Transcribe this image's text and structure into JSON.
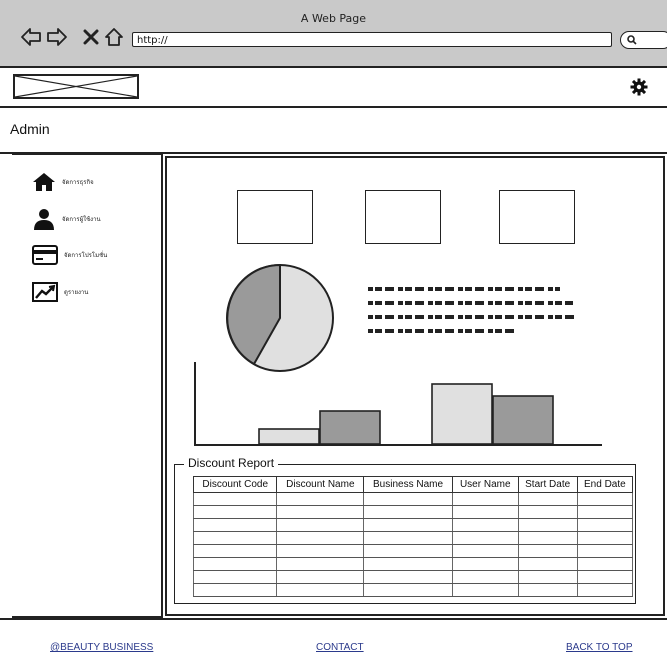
{
  "browser": {
    "title": "A Web Page",
    "url": "http://"
  },
  "header": {
    "admin_label": "Admin"
  },
  "sidebar": {
    "items": [
      {
        "label": "จัดการธุรกิจ",
        "icon": "home-icon"
      },
      {
        "label": "จัดการผู้ใช้งาน",
        "icon": "user-icon"
      },
      {
        "label": "จัดการโปรโมชั่น",
        "icon": "credit-card-icon"
      },
      {
        "label": "ดูรายงาน",
        "icon": "trend-chart-icon"
      }
    ]
  },
  "report": {
    "title": "Discount Report",
    "columns": [
      "Discount Code",
      "Discount Name",
      "Business Name",
      "User Name",
      "Start Date",
      "End Date"
    ],
    "row_count": 8
  },
  "footer": {
    "brand": "@BEAUTY BUSINESS",
    "contact": "CONTACT",
    "back_to_top": "BACK TO TOP"
  },
  "colors": {
    "chrome_bg": "#c9c9c9",
    "light_fill": "#e0e0e0",
    "mid_fill": "#9a9a9a",
    "link": "#2b3a8c"
  }
}
